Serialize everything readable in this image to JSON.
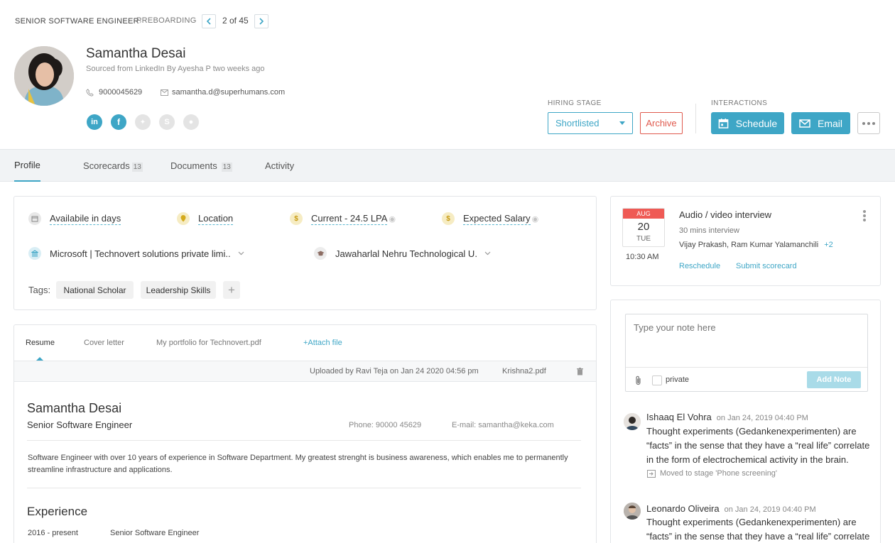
{
  "breadcrumb": {
    "job": "SENIOR SOFTWARE ENGINEER",
    "stage": "PREBOARDING",
    "pager": "2 of 45"
  },
  "candidate": {
    "name": "Samantha Desai",
    "source": "Sourced from LinkedIn By Ayesha P two weeks ago",
    "phone": "9000045629",
    "email": "samantha.d@superhumans.com"
  },
  "hiring": {
    "label": "HIRING STAGE",
    "stage": "Shortlisted",
    "archive": "Archive"
  },
  "interactions": {
    "label": "INTERACTIONS",
    "schedule": "Schedule",
    "email": "Email"
  },
  "tabs": {
    "profile": "Profile",
    "scorecards": "Scorecards",
    "scorecards_count": "13",
    "documents": "Documents",
    "documents_count": "13",
    "activity": "Activity"
  },
  "details": {
    "availability": "Availabile in days",
    "location": "Location",
    "current": "Current - 24.5 LPA",
    "expected": "Expected Salary",
    "company": "Microsoft | Technovert solutions private limi..",
    "college": "Jawaharlal Nehru Technological U.",
    "tags_label": "Tags:",
    "tags": [
      "National Scholar",
      "Leadership Skills"
    ]
  },
  "docs": {
    "tabs": [
      "Resume",
      "Cover letter",
      "My portfolio for Technovert.pdf"
    ],
    "attach": "+Attach file",
    "uploaded": "Uploaded by Ravi Teja on Jan 24 2020 04:56 pm",
    "filename": "Krishna2.pdf"
  },
  "resume": {
    "name": "Samantha Desai",
    "title": "Senior Software Engineer",
    "phone": "Phone: 90000 45629",
    "email": "E-mail: samantha@keka.com",
    "summary": "Software Engineer with over 10 years of experience in Software Department. My greatest strenght is business awareness, which enables me to permanently streamline infrastructure and applications.",
    "experience_heading": "Experience",
    "exp_period": "2016 - present",
    "exp_role": "Senior Software Engineer"
  },
  "interview": {
    "month": "AUG",
    "day": "20",
    "weekday": "TUE",
    "time": "10:30 AM",
    "title": "Audio / video interview",
    "duration": "30 mins interview",
    "people": "Vijay Prakash, Ram Kumar Yalamanchili",
    "more": "+2",
    "reschedule": "Reschedule",
    "scorecard": "Submit scorecard"
  },
  "note": {
    "placeholder": "Type your note here",
    "private": "private",
    "add": "Add Note"
  },
  "comments": [
    {
      "author": "Ishaaq El Vohra",
      "date": "on Jan 24, 2019 04:40 PM",
      "text": "Thought experiments (Gedankenexperimenten) are “facts” in the sense that they have a “real life” correlate in the form of electrochemical activity in the brain.",
      "event": "Moved to stage 'Phone screening'"
    },
    {
      "author": "Leonardo Oliveira",
      "date": "on Jan 24, 2019 04:40 PM",
      "text": "Thought experiments (Gedankenexperimenten) are “facts” in the sense that they have a “real life” correlate"
    }
  ],
  "colors": {
    "accent": "#3ea6c6",
    "archive": "#e05a4e",
    "date_badge": "#ef5a55"
  }
}
